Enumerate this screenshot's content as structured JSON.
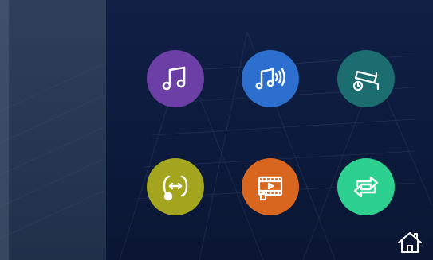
{
  "screen": {
    "background_color": "#0f1e43",
    "left_panel_color": "#3d5266"
  },
  "apps": [
    {
      "name": "music",
      "icon": "music-note-icon",
      "color": "#6b3fa6"
    },
    {
      "name": "ringtone",
      "icon": "music-volume-icon",
      "color": "#2c6fce"
    },
    {
      "name": "camera",
      "icon": "cctv-camera-clock-icon",
      "color": "#1b6d6f"
    },
    {
      "name": "transfer",
      "icon": "phone-transfer-icon",
      "color": "#a4a51f"
    },
    {
      "name": "video",
      "icon": "film-delete-icon",
      "color": "#d9661f"
    },
    {
      "name": "switch",
      "icon": "switch-arrows-icon",
      "color": "#2ed08f"
    }
  ],
  "home": {
    "icon": "home-icon"
  }
}
